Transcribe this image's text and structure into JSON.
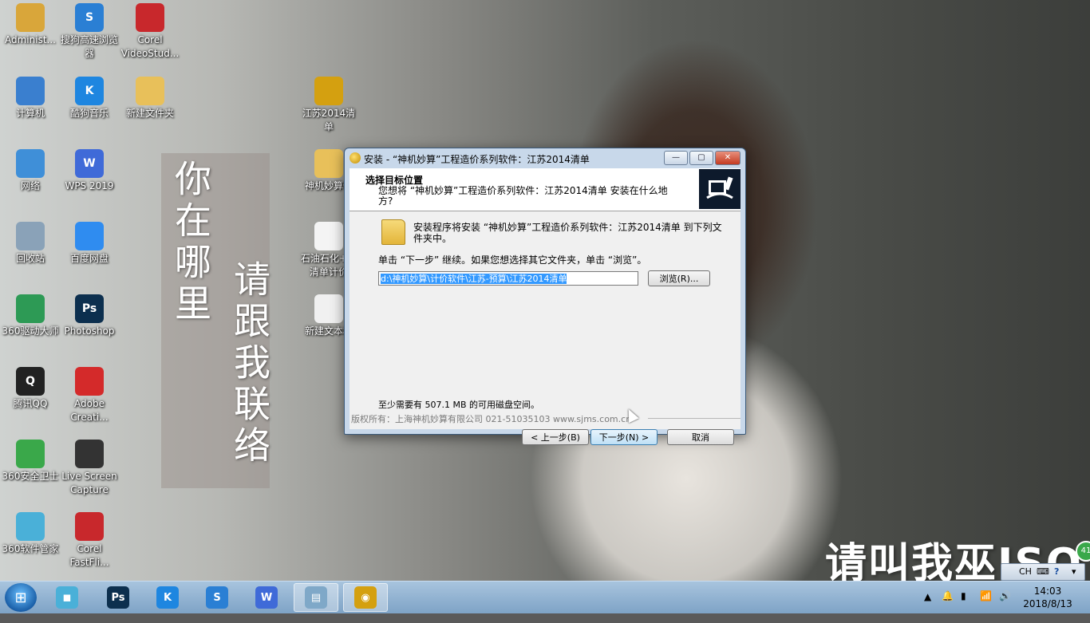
{
  "desktop": {
    "icons": [
      {
        "label": "Administ...",
        "icon": "user-folder-icon",
        "color": "#d9a63a"
      },
      {
        "label": "搜狗高速浏览器",
        "icon": "sogou-browser-icon",
        "color": "#2a7fd4"
      },
      {
        "label": "Corel VideoStud...",
        "icon": "corel-video-icon",
        "color": "#c8282c"
      },
      {
        "label": "计算机",
        "icon": "computer-icon",
        "color": "#3a7fcf"
      },
      {
        "label": "酷狗音乐",
        "icon": "kugou-icon",
        "color": "#1e86e0"
      },
      {
        "label": "新建文件夹",
        "icon": "folder-icon",
        "color": "#e8c05a"
      },
      {
        "label": "网络",
        "icon": "network-icon",
        "color": "#3f8fd8"
      },
      {
        "label": "WPS 2019",
        "icon": "wps-icon",
        "color": "#3f6ad8"
      },
      {
        "label": "回收站",
        "icon": "recycle-bin-icon",
        "color": "#8aa2b8"
      },
      {
        "label": "百度网盘",
        "icon": "baidu-netdisk-icon",
        "color": "#2f8cf0"
      },
      {
        "label": "360驱动大师",
        "icon": "driver-master-icon",
        "color": "#2d9a55"
      },
      {
        "label": "Photoshop",
        "icon": "photoshop-icon",
        "color": "#0c2f4e"
      },
      {
        "label": "腾讯QQ",
        "icon": "qq-icon",
        "color": "#222222"
      },
      {
        "label": "Adobe Creati...",
        "icon": "adobe-cc-icon",
        "color": "#d42a2a"
      },
      {
        "label": "360安全卫士",
        "icon": "360-safe-icon",
        "color": "#3aa84a"
      },
      {
        "label": "Live Screen Capture",
        "icon": "screen-capture-icon",
        "color": "#333333"
      },
      {
        "label": "360软件管家",
        "icon": "360-software-icon",
        "color": "#4ab0d8"
      },
      {
        "label": "Corel FastFli...",
        "icon": "corel-fastflick-icon",
        "color": "#c8282c"
      },
      {
        "label": "江苏2014清单",
        "icon": "coin-app-icon",
        "color": "#d4a010"
      },
      {
        "label": "神机妙算件",
        "icon": "folder-doc-icon",
        "color": "#e8c05a"
      },
      {
        "label": "石油石化+方清单计价",
        "icon": "doc-thumb-icon",
        "color": "#f4f4f4"
      },
      {
        "label": "新建文本档",
        "icon": "text-file-icon",
        "color": "#f0f0f0"
      }
    ],
    "poem_line1": "你在哪里",
    "poem_line2": "请跟我联络",
    "corner_text": "请叫我巫ISO"
  },
  "dialog": {
    "title": "安装 - “神机妙算”工程造价系列软件：江苏2014清单",
    "min_label": "—",
    "max_label": "▢",
    "close_label": "✕",
    "header_title": "选择目标位置",
    "header_subtitle": "您想将 “神机妙算”工程造价系列软件：江苏2014清单 安装在什么地方?",
    "intro_text": "安装程序将安装 “神机妙算”工程造价系列软件：江苏2014清单 到下列文件夹中。",
    "instruction": "单击 “下一步” 继续。如果您想选择其它文件夹，单击 “浏览”。",
    "path_value": "d:\\神机妙算\\计价软件\\江苏-预算\\江苏2014清单",
    "browse_label": "浏览(R)...",
    "space_text": "至少需要有 507.1 MB 的可用磁盘空间。",
    "copyright": "版权所有：上海神机妙算有限公司 021-51035103  www.sjms.com.cn",
    "back_label": "< 上一步(B)",
    "next_label": "下一步(N) >",
    "cancel_label": "取消"
  },
  "taskbar": {
    "start_label": "⊞",
    "apps": [
      {
        "icon": "360-software-icon",
        "glyph": "◼",
        "color": "#4ab0d8"
      },
      {
        "icon": "photoshop-icon",
        "glyph": "Ps",
        "color": "#0c2f4e"
      },
      {
        "icon": "kugou-icon",
        "glyph": "K",
        "color": "#1e86e0"
      },
      {
        "icon": "sogou-browser-icon",
        "glyph": "S",
        "color": "#2a7fd4"
      },
      {
        "icon": "wps-icon",
        "glyph": "W",
        "color": "#3f6ad8"
      },
      {
        "icon": "notebook-icon",
        "glyph": "▤",
        "color": "#7fa8c8"
      },
      {
        "icon": "coin-app-icon",
        "glyph": "◉",
        "color": "#d4a010"
      }
    ],
    "lang": "CH",
    "tray_help": "?",
    "time": "14:03",
    "date": "2018/8/13",
    "badge": "41"
  }
}
